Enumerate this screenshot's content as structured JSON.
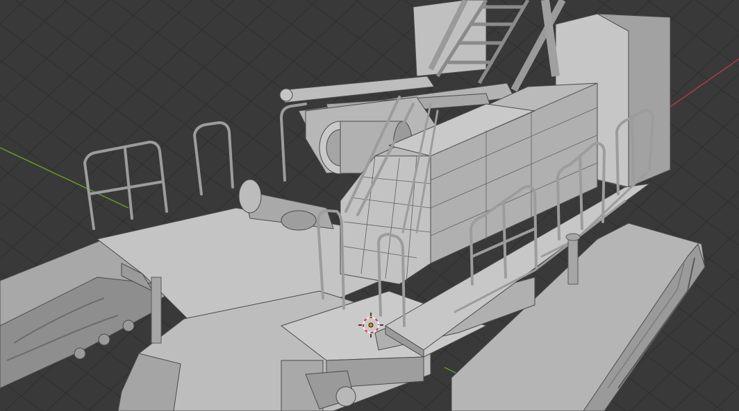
{
  "viewport": {
    "view": "3D Viewport",
    "shading": "solid",
    "subject": "crane-model",
    "colors": {
      "background": "#393939",
      "grid_line": "#2f2f2f",
      "x_axis": "#b33a45",
      "y_axis": "#6a9a25",
      "model_light": "#c2c2c2",
      "model_mid": "#a8a8a8",
      "model_dark": "#8a8a8a",
      "model_edge": "#4a4a4a",
      "cursor_ring_red": "#d93a3a",
      "cursor_ring_white": "#f0f0f0",
      "cursor_center": "#e08a1a"
    },
    "gizmos": [
      "3d-cursor-icon",
      "x-axis-line",
      "y-axis-line",
      "floor-grid"
    ]
  }
}
